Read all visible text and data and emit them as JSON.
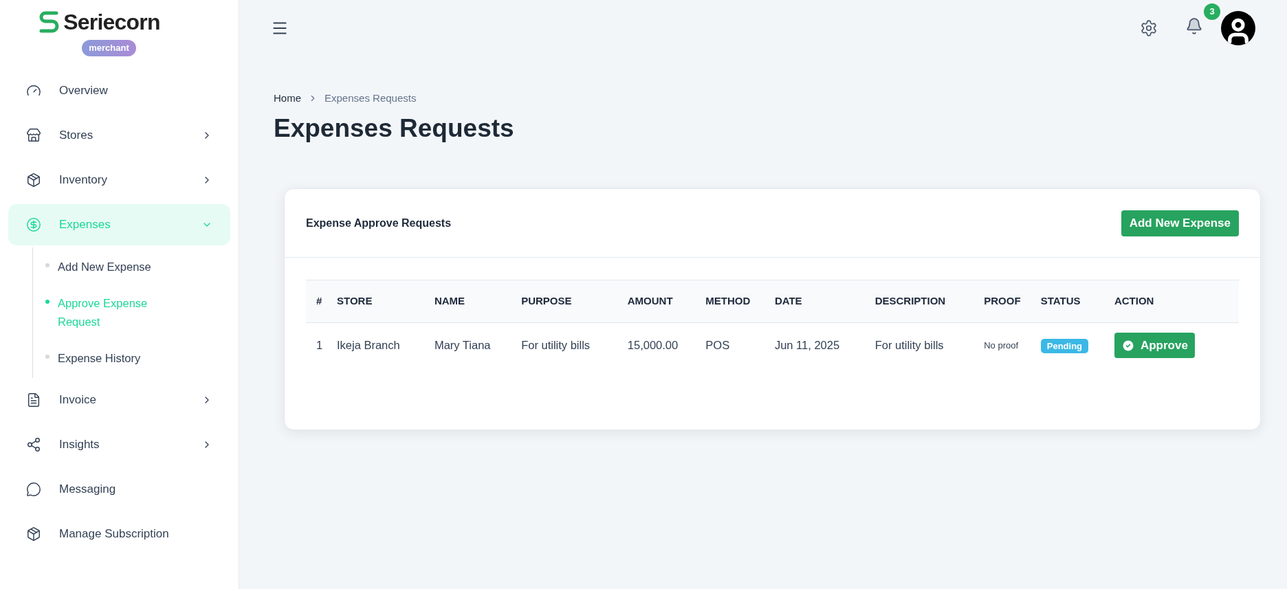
{
  "brand": {
    "name": "Seriecorn",
    "badge": "merchant"
  },
  "sidebar": {
    "items": [
      {
        "label": "Overview",
        "kind": "link",
        "selected": false
      },
      {
        "label": "Stores",
        "kind": "group",
        "selected": false,
        "expanded": false
      },
      {
        "label": "Inventory",
        "kind": "group",
        "selected": false,
        "expanded": false
      },
      {
        "label": "Expenses",
        "kind": "group",
        "selected": true,
        "expanded": true,
        "children": [
          {
            "label": "Add New Expense",
            "selected": false
          },
          {
            "label": "Approve Expense Request",
            "selected": true
          },
          {
            "label": "Expense History",
            "selected": false
          }
        ]
      },
      {
        "label": "Invoice",
        "kind": "group",
        "selected": false,
        "expanded": false
      },
      {
        "label": "Insights",
        "kind": "group",
        "selected": false,
        "expanded": false
      },
      {
        "label": "Messaging",
        "kind": "link",
        "selected": false
      },
      {
        "label": "Manage Subscription",
        "kind": "link",
        "selected": false
      }
    ]
  },
  "header": {
    "notification_count": "3"
  },
  "breadcrumb": [
    "Home",
    "Expenses Requests"
  ],
  "page_title": "Expenses Requests",
  "card": {
    "title": "Expense Approve Requests",
    "button": "Add New Expense",
    "table": {
      "columns": [
        "#",
        "STORE",
        "NAME",
        "PURPOSE",
        "AMOUNT",
        "METHOD",
        "DATE",
        "DESCRIPTION",
        "PROOF",
        "STATUS",
        "ACTION"
      ],
      "rows": [
        {
          "cells": [
            "1",
            "Ikeja Branch",
            "Mary Tiana",
            "For utility bills",
            "15,000.00",
            "POS",
            "Jun 11, 2025",
            "For utility bills"
          ],
          "proof": "No proof",
          "status": "Pending",
          "action": "Approve"
        }
      ]
    }
  }
}
